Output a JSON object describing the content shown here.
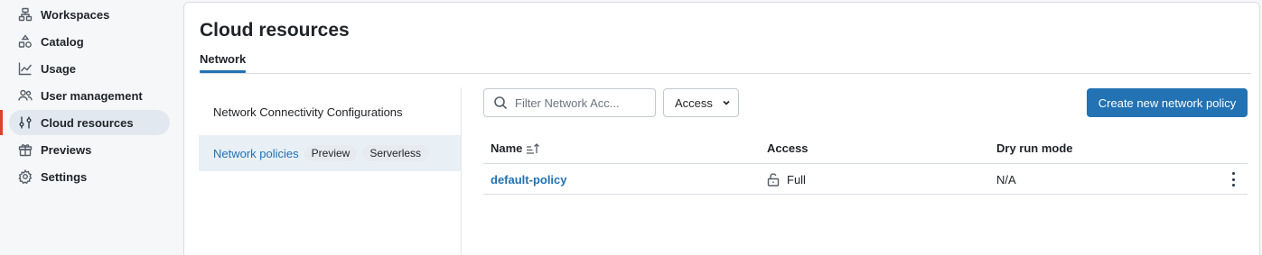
{
  "sidebar": {
    "items": [
      {
        "label": "Workspaces",
        "icon": "workspaces-icon"
      },
      {
        "label": "Catalog",
        "icon": "catalog-icon"
      },
      {
        "label": "Usage",
        "icon": "usage-chart-icon"
      },
      {
        "label": "User management",
        "icon": "users-icon"
      },
      {
        "label": "Cloud resources",
        "icon": "cloud-resources-icon",
        "active": true
      },
      {
        "label": "Previews",
        "icon": "gift-icon"
      },
      {
        "label": "Settings",
        "icon": "gear-icon"
      }
    ]
  },
  "page": {
    "title": "Cloud resources",
    "tabs": [
      {
        "label": "Network",
        "active": true
      }
    ]
  },
  "subnav": {
    "items": [
      {
        "label": "Network Connectivity Configurations"
      },
      {
        "label": "Network policies",
        "badges": [
          "Preview",
          "Serverless"
        ],
        "selected": true
      }
    ]
  },
  "toolbar": {
    "filter_placeholder": "Filter Network Acc...",
    "access_label": "Access",
    "create_label": "Create new network policy"
  },
  "table": {
    "columns": [
      "Name",
      "Access",
      "Dry run mode"
    ],
    "rows": [
      {
        "name": "default-policy",
        "access": "Full",
        "dry_run": "N/A"
      }
    ]
  },
  "colors": {
    "accent": "#2272b4",
    "active_indicator": "#e03f2a",
    "active_bg": "#e2e8ef"
  }
}
